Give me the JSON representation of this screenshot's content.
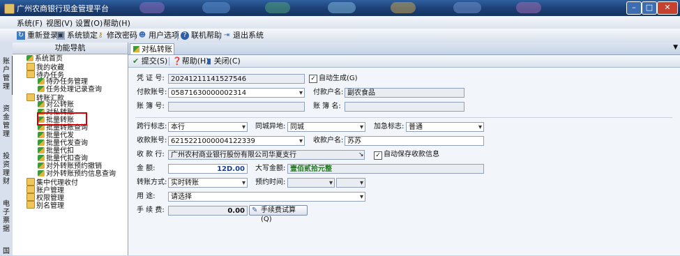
{
  "window": {
    "title": "广州农商银行现金管理平台",
    "min": "–",
    "max": "□",
    "close": "✕"
  },
  "menu": [
    "系统(F)",
    "视图(V)",
    "设置(O)",
    "帮助(H)"
  ],
  "toolbar": [
    "重新登录",
    "系统锁定",
    "修改密码",
    "用户选项",
    "联机帮助",
    "退出系统"
  ],
  "vtabs": [
    "账户管理",
    "资金管理",
    "投资理财",
    "电子票据",
    "国"
  ],
  "nav": {
    "title": "功能导航",
    "items": [
      "系统首页",
      "我的收藏",
      "待办任务",
      "待办任务管理",
      "任务处理记录查询",
      "转账汇款",
      "对公转账",
      "对私转账",
      "批量转账",
      "批量转账查询",
      "批量代发",
      "批量代发查询",
      "批量代扣",
      "批量代扣查询",
      "对外转账预约撤销",
      "对外转账预约信息查询",
      "集中代理收付",
      "账户管理",
      "权限管理",
      "别名管理"
    ]
  },
  "tab": {
    "label": "对私转账",
    "menu_arrow": "▼"
  },
  "actions": {
    "submit": "提交(S)",
    "help": "帮助(H)",
    "close": "关闭(C)"
  },
  "form": {
    "voucher_label": "凭 证 号:",
    "voucher_value": "20241211141527546",
    "autogen_label": "自动生成(G)",
    "autogen_checked": "✓",
    "pay_account_label": "付款账号:",
    "pay_account_value": "05871630000002314",
    "payer_name_label": "付款户名:",
    "payer_name_value": "副农食品",
    "book_no_label": "账 簿 号:",
    "book_no_value": "",
    "book_name_label": "账 簿 名:",
    "book_name_value": "",
    "crossbank_label": "跨行标志:",
    "crossbank_value": "本行",
    "samecity_label": "同城异地:",
    "samecity_value": "同城",
    "urgent_label": "加急标志:",
    "urgent_value": "普通",
    "recv_account_label": "收款账号:",
    "recv_account_value": "6215221000004122339",
    "recv_name_label": "收款户名:",
    "recv_name_value": "苏苏",
    "recv_bank_label": "收 款 行:",
    "recv_bank_value": "广州农村商业银行股份有限公司华夏支行",
    "autosave_label": "自动保存收款信息",
    "autosave_checked": "✓",
    "amount_label": "金    额:",
    "amount_value": "12D.00",
    "amount_upper_label": "大写金额:",
    "amount_upper_value": "壹佰贰拾元整",
    "transfer_mode_label": "转账方式:",
    "transfer_mode_value": "实时转账",
    "appoint_time_label": "预约时间:",
    "appoint_time_value": "",
    "purpose_label": "用    途:",
    "purpose_value": "请选择",
    "fee_label": "手 续 费:",
    "fee_value": "0.00",
    "fee_calc_button": "手续费试算(Q)"
  },
  "colors": {
    "title_bar": "#1c3f75",
    "highlight_box": "#d40000",
    "panel_bg": "#e6ecf4"
  }
}
